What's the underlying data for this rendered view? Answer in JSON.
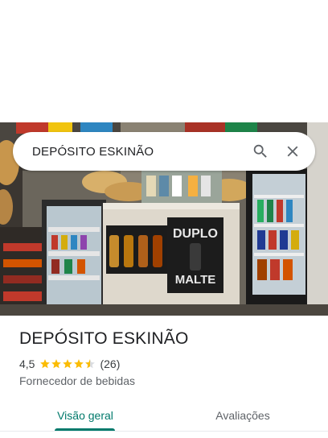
{
  "search": {
    "query": "DEPÓSITO ESKINÃO",
    "search_icon": "search-icon",
    "clear_icon": "close-icon"
  },
  "photo": {
    "poster_line1": "DUPLO",
    "poster_line2": "MALTE"
  },
  "place": {
    "name": "DEPÓSITO ESKINÃO",
    "rating": "4,5",
    "stars_value": 4.5,
    "review_count": "(26)",
    "category": "Fornecedor de bebidas"
  },
  "tabs": [
    {
      "label": "Visão geral",
      "active": true
    },
    {
      "label": "Avaliações",
      "active": false
    }
  ],
  "colors": {
    "accent": "#00796b",
    "star": "#fbbc04",
    "text_primary": "#202124",
    "text_secondary": "#5f6368"
  }
}
